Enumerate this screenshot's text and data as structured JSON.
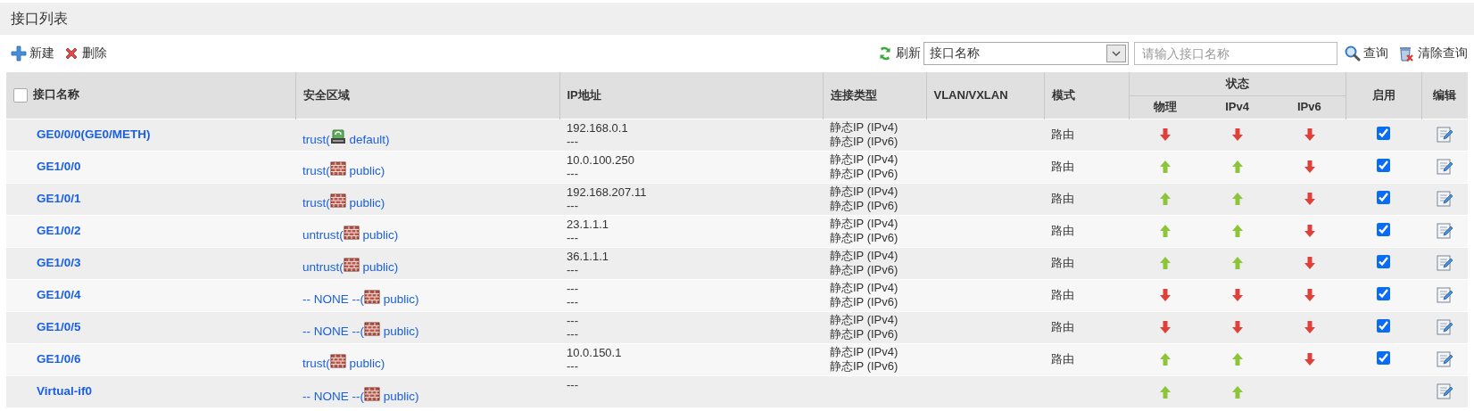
{
  "title": "接口列表",
  "toolbar": {
    "left": [
      {
        "kind": "add",
        "label": "新建"
      },
      {
        "kind": "delete",
        "label": "删除"
      }
    ],
    "refresh": "刷新",
    "filter": {
      "value": "接口名称"
    },
    "search": {
      "placeholder": "请输入接口名称"
    },
    "right": [
      {
        "kind": "search",
        "label": "查询"
      },
      {
        "kind": "clear",
        "label": "清除查询"
      }
    ]
  },
  "table": {
    "select_all": {
      "checked": false
    },
    "columns": [
      "接口名称",
      "安全区域",
      "IP地址",
      "连接类型",
      "VLAN/VXLAN",
      "模式"
    ],
    "status_group": "状态",
    "status_columns": [
      "物理",
      "IPv4",
      "IPv6"
    ],
    "enable_column": "启用",
    "edit_column": "编辑",
    "rows": [
      {
        "name": "GE0/0/0(GE0/METH)",
        "zone_pre": "trust(",
        "zone_icon": {
          "kind": "device"
        },
        "zone_post": "default)",
        "ip": [
          "192.168.0.1",
          "---"
        ],
        "conn": [
          "静态IP (IPv4)",
          "静态IP (IPv6)"
        ],
        "mode": "路由",
        "status": [
          {
            "up": false
          },
          {
            "up": false
          },
          {
            "up": false
          }
        ],
        "enabled": true
      },
      {
        "name": "GE1/0/0",
        "zone_pre": "trust(",
        "zone_icon": {
          "kind": "wall"
        },
        "zone_post": "public)",
        "ip": [
          "10.0.100.250",
          "---"
        ],
        "conn": [
          "静态IP (IPv4)",
          "静态IP (IPv6)"
        ],
        "mode": "路由",
        "status": [
          {
            "up": true
          },
          {
            "up": true
          },
          {
            "up": false
          }
        ],
        "enabled": true
      },
      {
        "name": "GE1/0/1",
        "zone_pre": "trust(",
        "zone_icon": {
          "kind": "wall"
        },
        "zone_post": "public)",
        "ip": [
          "192.168.207.11",
          "---"
        ],
        "conn": [
          "静态IP (IPv4)",
          "静态IP (IPv6)"
        ],
        "mode": "路由",
        "status": [
          {
            "up": true
          },
          {
            "up": true
          },
          {
            "up": false
          }
        ],
        "enabled": true
      },
      {
        "name": "GE1/0/2",
        "zone_pre": "untrust(",
        "zone_icon": {
          "kind": "wall"
        },
        "zone_post": "public)",
        "ip": [
          "23.1.1.1",
          "---"
        ],
        "conn": [
          "静态IP (IPv4)",
          "静态IP (IPv6)"
        ],
        "mode": "路由",
        "status": [
          {
            "up": true
          },
          {
            "up": true
          },
          {
            "up": false
          }
        ],
        "enabled": true
      },
      {
        "name": "GE1/0/3",
        "zone_pre": "untrust(",
        "zone_icon": {
          "kind": "wall"
        },
        "zone_post": "public)",
        "ip": [
          "36.1.1.1",
          "---"
        ],
        "conn": [
          "静态IP (IPv4)",
          "静态IP (IPv6)"
        ],
        "mode": "路由",
        "status": [
          {
            "up": true
          },
          {
            "up": true
          },
          {
            "up": false
          }
        ],
        "enabled": true
      },
      {
        "name": "GE1/0/4",
        "zone_pre": "-- NONE --(",
        "zone_icon": {
          "kind": "wall"
        },
        "zone_post": "public)",
        "ip": [
          "---",
          "---"
        ],
        "conn": [
          "静态IP (IPv4)",
          "静态IP (IPv6)"
        ],
        "mode": "路由",
        "status": [
          {
            "up": false
          },
          {
            "up": false
          },
          {
            "up": false
          }
        ],
        "enabled": true
      },
      {
        "name": "GE1/0/5",
        "zone_pre": "-- NONE --(",
        "zone_icon": {
          "kind": "wall"
        },
        "zone_post": "public)",
        "ip": [
          "---",
          "---"
        ],
        "conn": [
          "静态IP (IPv4)",
          "静态IP (IPv6)"
        ],
        "mode": "路由",
        "status": [
          {
            "up": false
          },
          {
            "up": false
          },
          {
            "up": false
          }
        ],
        "enabled": true
      },
      {
        "name": "GE1/0/6",
        "zone_pre": "trust(",
        "zone_icon": {
          "kind": "wall"
        },
        "zone_post": "public)",
        "ip": [
          "10.0.150.1",
          "---"
        ],
        "conn": [
          "静态IP (IPv4)",
          "静态IP (IPv6)"
        ],
        "mode": "路由",
        "status": [
          {
            "up": true
          },
          {
            "up": true
          },
          {
            "up": false
          }
        ],
        "enabled": true
      },
      {
        "name": "Virtual-if0",
        "zone_pre": "-- NONE --(",
        "zone_icon": {
          "kind": "wall"
        },
        "zone_post": "public)",
        "ip": [
          "---"
        ],
        "conn": [],
        "status": [
          {
            "up": true
          },
          {
            "up": true
          }
        ]
      }
    ]
  }
}
